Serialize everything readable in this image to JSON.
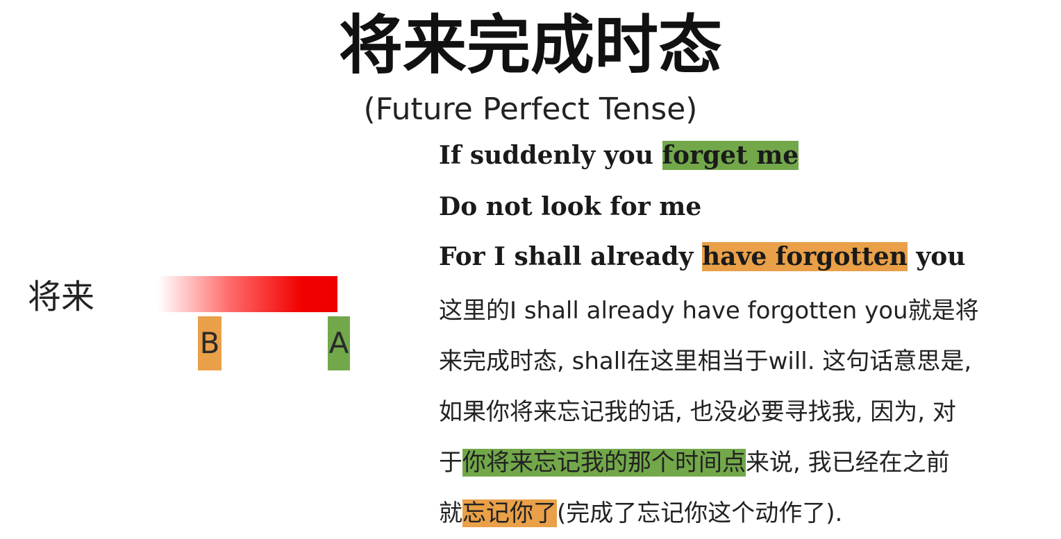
{
  "title": "将来完成时态",
  "subtitle": "(Future Perfect Tense)",
  "timeline": {
    "label": "将来",
    "marker_b": "B",
    "marker_a": "A"
  },
  "poem": {
    "line1_pre": "If suddenly you ",
    "line1_hl": "forget me",
    "line2": "Do not look for me",
    "line3_pre": "For I shall already ",
    "line3_hl": "have forgotten",
    "line3_post": " you"
  },
  "explanation": {
    "l1": "这里的I shall already have forgotten you就是将",
    "l2": "来完成时态, shall在这里相当于will. 这句话意思是,",
    "l3": "如果你将来忘记我的话, 也没必要寻找我, 因为, 对",
    "l4_pre": "于",
    "l4_hl": "你将来忘记我的那个时间点",
    "l4_post": "来说, 我已经在之前",
    "l5_pre": "就",
    "l5_hl": "忘记你了",
    "l5_post": "(完成了忘记你这个动作了)."
  },
  "colors": {
    "green_highlight": "#72a84a",
    "orange_highlight": "#e9a048",
    "timeline_red": "#ee0000"
  }
}
